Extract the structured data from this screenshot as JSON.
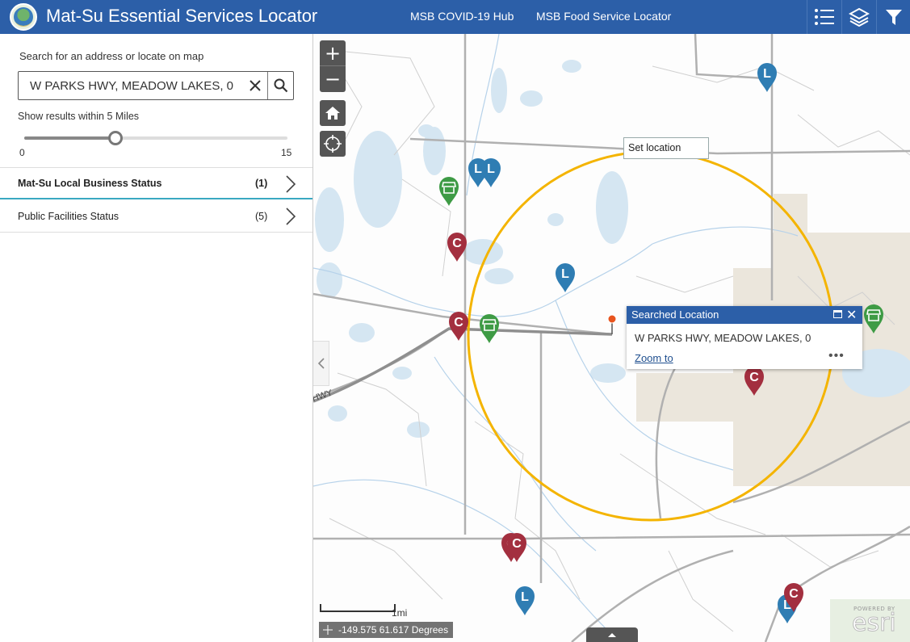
{
  "header": {
    "title": "Mat-Su Essential Services Locator",
    "links": [
      "MSB COVID-19 Hub",
      "MSB Food Service Locator"
    ],
    "logo_icon": "borough-seal-logo",
    "tool_icons": [
      "legend-list-icon",
      "layers-icon",
      "filter-icon"
    ],
    "background": "#2c5fa8"
  },
  "panel": {
    "search_label": "Search for an address or locate on map",
    "search_value": "W PARKS HWY, MEADOW LAKES, 0",
    "radius_label": "Show results within 5 Miles",
    "slider": {
      "min": "0",
      "max": "15",
      "value": 5
    },
    "layers": [
      {
        "name": "Mat-Su Local Business Status",
        "count": "(1)",
        "selected": true
      },
      {
        "name": "Public Facilities Status",
        "count": "(5)",
        "selected": false
      }
    ]
  },
  "map": {
    "set_location_label": "Set location",
    "highway_label": "HWY",
    "popup": {
      "title": "Searched Location",
      "address": "W PARKS HWY, MEADOW LAKES, 0",
      "zoom_link": "Zoom to",
      "more": "•••"
    },
    "scale_label": "1mi",
    "coordinates": "-149.575 61.617 Degrees",
    "attribution_powered": "POWERED BY",
    "attribution_brand": "esri",
    "circle_color": "#f4b400",
    "marker_colors": {
      "library": "#2f7db3",
      "community": "#a32f3f",
      "store": "#3e9b45"
    },
    "markers": [
      {
        "letter": "L",
        "kind": "library"
      },
      {
        "letter": "L",
        "kind": "library"
      },
      {
        "letter": "L",
        "kind": "library"
      },
      {
        "letter": "L",
        "kind": "library"
      },
      {
        "letter": "L",
        "kind": "library"
      },
      {
        "letter": "L",
        "kind": "library"
      },
      {
        "letter": "C",
        "kind": "community"
      },
      {
        "letter": "C",
        "kind": "community"
      },
      {
        "letter": "C",
        "kind": "community"
      },
      {
        "letter": "C",
        "kind": "community"
      },
      {
        "letter": "C",
        "kind": "community"
      },
      {
        "letter": "C",
        "kind": "community"
      },
      {
        "kind": "store"
      },
      {
        "kind": "store"
      },
      {
        "kind": "store"
      }
    ]
  }
}
